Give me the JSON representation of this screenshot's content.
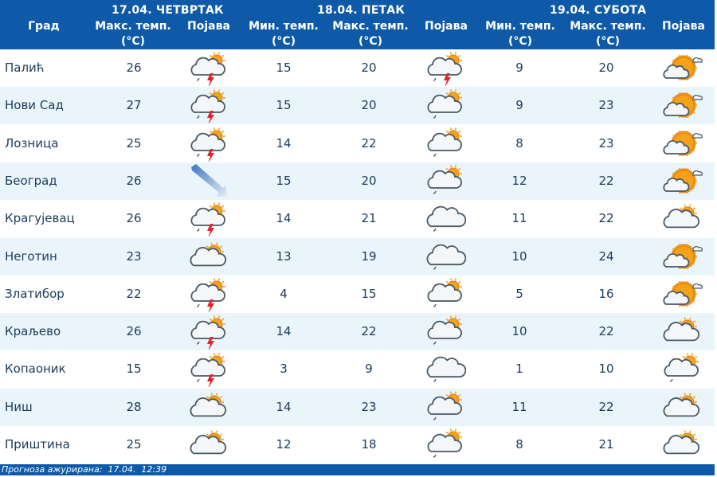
{
  "header": {
    "city_label": "Град",
    "days": [
      "17.04. ЧЕТВРТАК",
      "18.04. ПЕТАК",
      "19.04. СУБОТА"
    ],
    "max_temp_label": "Макс. темп.",
    "min_temp_label": "Мин. темп.",
    "unit_label": "(°C)",
    "phenomenon_label": "Појава"
  },
  "rows": [
    {
      "city": "Палић",
      "d1_max": "26",
      "d1_icon": "cloud-sun-thunderstorm-icon",
      "d2_min": "15",
      "d2_max": "20",
      "d2_icon": "cloud-sun-thunderstorm-icon",
      "d3_min": "9",
      "d3_max": "20",
      "d3_icon": "sun-cloud-icon"
    },
    {
      "city": "Нови Сад",
      "d1_max": "27",
      "d1_icon": "cloud-sun-thunderstorm-icon",
      "d2_min": "15",
      "d2_max": "20",
      "d2_icon": "cloud-sun-rain-icon",
      "d3_min": "9",
      "d3_max": "23",
      "d3_icon": "sun-cloud-icon"
    },
    {
      "city": "Лозница",
      "d1_max": "25",
      "d1_icon": "cloud-sun-thunderstorm-icon",
      "d2_min": "14",
      "d2_max": "22",
      "d2_icon": "cloud-sun-rain-icon",
      "d3_min": "8",
      "d3_max": "23",
      "d3_icon": "sun-cloud-icon"
    },
    {
      "city": "Београд",
      "d1_max": "26",
      "d1_icon": "wind-arrow-icon",
      "d2_min": "15",
      "d2_max": "20",
      "d2_icon": "cloud-sun-rain-icon",
      "d3_min": "12",
      "d3_max": "22",
      "d3_icon": "sun-cloud-icon"
    },
    {
      "city": "Крагујевац",
      "d1_max": "26",
      "d1_icon": "cloud-sun-thunderstorm-icon",
      "d2_min": "14",
      "d2_max": "21",
      "d2_icon": "cloud-rain-icon",
      "d3_min": "11",
      "d3_max": "22",
      "d3_icon": "partly-cloudy-icon"
    },
    {
      "city": "Неготин",
      "d1_max": "23",
      "d1_icon": "partly-cloudy-icon",
      "d2_min": "13",
      "d2_max": "19",
      "d2_icon": "cloud-rain-icon",
      "d3_min": "10",
      "d3_max": "24",
      "d3_icon": "sun-cloud-icon"
    },
    {
      "city": "Златибор",
      "d1_max": "22",
      "d1_icon": "cloud-sun-thunderstorm-icon",
      "d2_min": "4",
      "d2_max": "15",
      "d2_icon": "cloud-sun-rain-icon",
      "d3_min": "5",
      "d3_max": "16",
      "d3_icon": "sun-cloud-icon"
    },
    {
      "city": "Краљево",
      "d1_max": "26",
      "d1_icon": "cloud-sun-thunderstorm-icon",
      "d2_min": "14",
      "d2_max": "22",
      "d2_icon": "cloud-sun-rain-icon",
      "d3_min": "10",
      "d3_max": "22",
      "d3_icon": "partly-cloudy-icon"
    },
    {
      "city": "Копаоник",
      "d1_max": "15",
      "d1_icon": "cloud-sun-thunderstorm-icon",
      "d2_min": "3",
      "d2_max": "9",
      "d2_icon": "cloud-rain-icon",
      "d3_min": "1",
      "d3_max": "10",
      "d3_icon": "cloud-sun-rain-icon"
    },
    {
      "city": "Ниш",
      "d1_max": "28",
      "d1_icon": "partly-cloudy-icon",
      "d2_min": "14",
      "d2_max": "23",
      "d2_icon": "cloud-sun-rain-icon",
      "d3_min": "11",
      "d3_max": "22",
      "d3_icon": "partly-cloudy-icon"
    },
    {
      "city": "Приштина",
      "d1_max": "25",
      "d1_icon": "partly-cloudy-icon",
      "d2_min": "12",
      "d2_max": "18",
      "d2_icon": "cloud-sun-rain-icon",
      "d3_min": "8",
      "d3_max": "21",
      "d3_icon": "partly-cloudy-icon"
    }
  ],
  "footer": {
    "updated_text": "Прогноза ажурирана:  17.04.  12:39"
  },
  "colors": {
    "header_bg": "#0f5aa8",
    "row_alt_bg": "#e9f5fb",
    "text": "#1d3a58",
    "sun": "#f5a21a",
    "lightning": "#e0262a"
  }
}
